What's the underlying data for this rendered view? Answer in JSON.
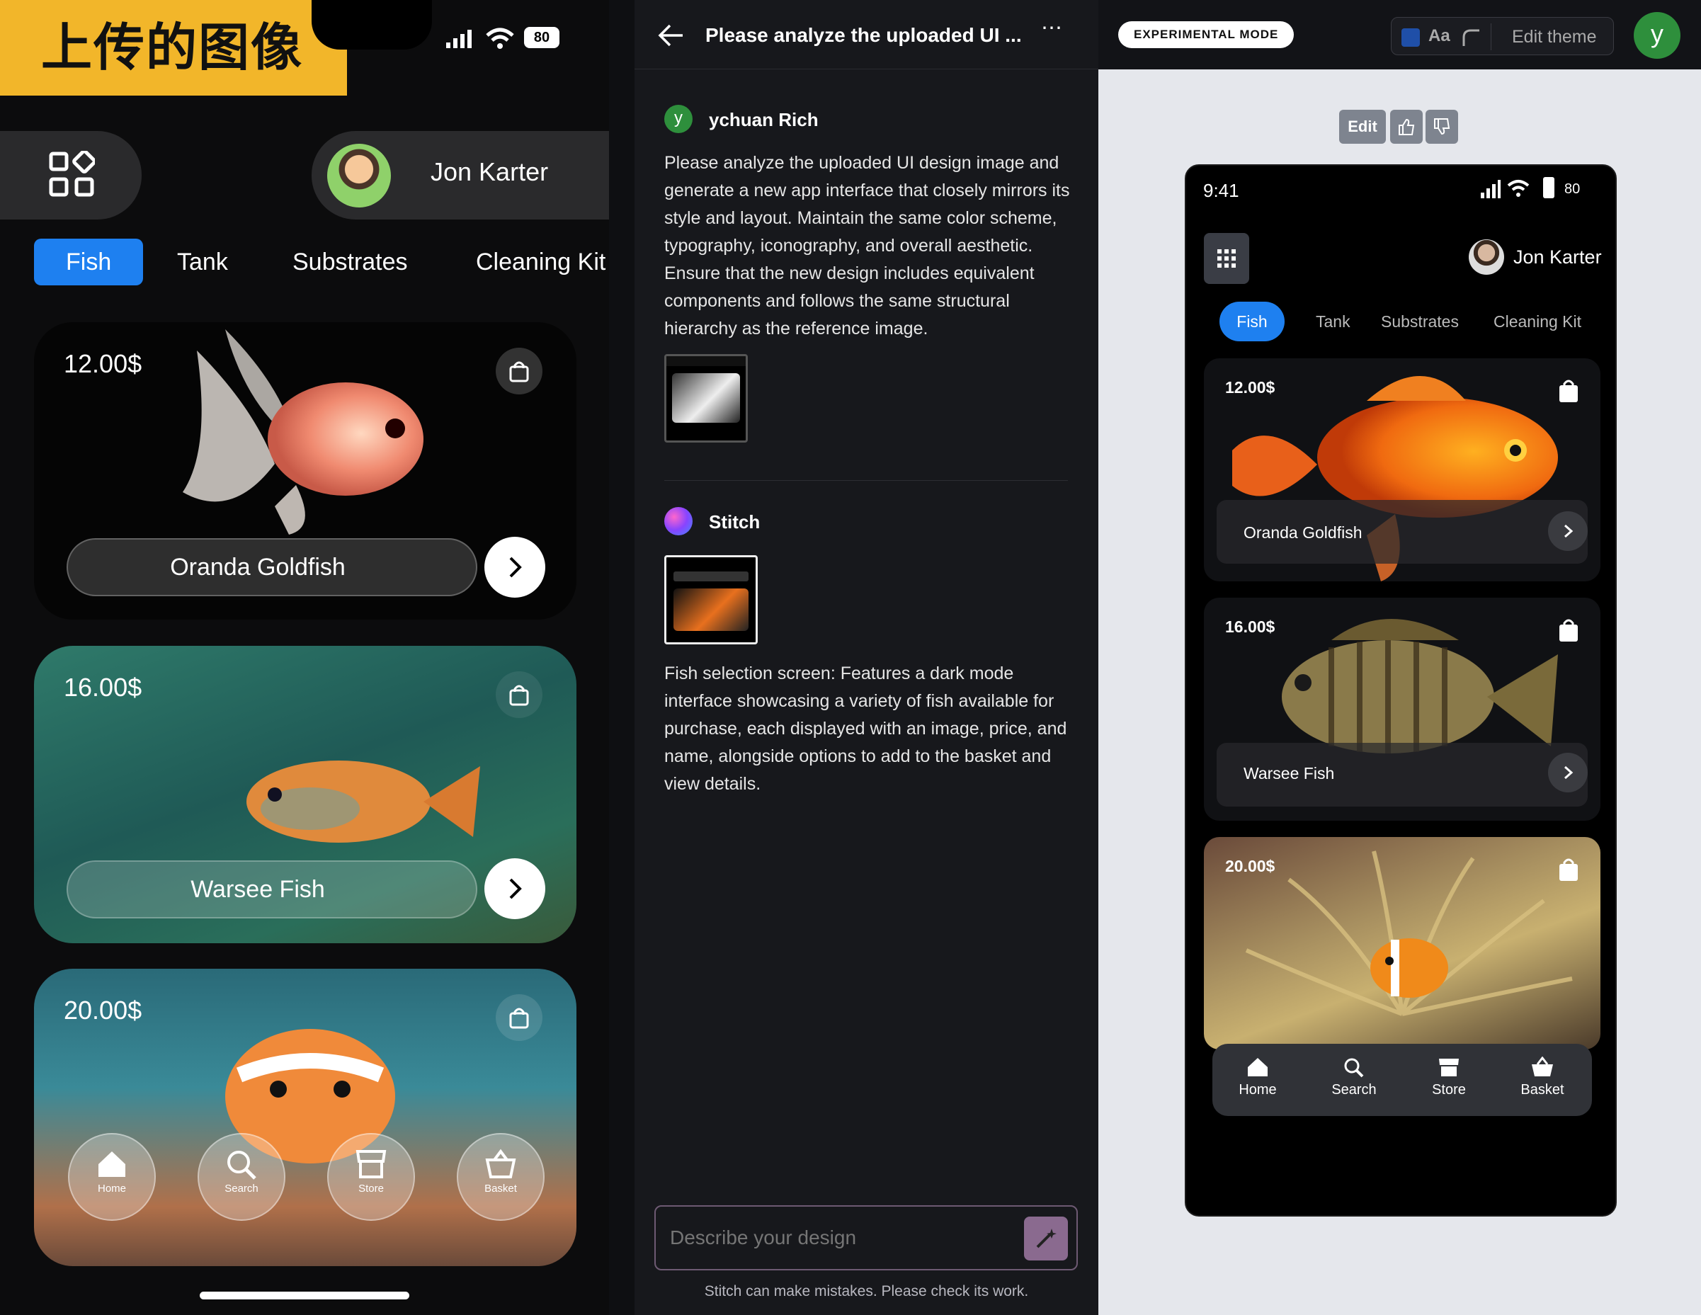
{
  "uploaded": {
    "banner": "上传的图像",
    "battery": "80",
    "user_name": "Jon Karter",
    "tabs": [
      "Fish",
      "Tank",
      "Substrates",
      "Cleaning Kit"
    ],
    "cards": [
      {
        "price": "12.00$",
        "name": "Oranda Goldfish"
      },
      {
        "price": "16.00$",
        "name": "Warsee Fish"
      },
      {
        "price": "20.00$"
      }
    ],
    "nav": [
      "Home",
      "Search",
      "Store",
      "Basket"
    ]
  },
  "chat": {
    "title": "Please analyze the uploaded UI ...",
    "user_initial": "y",
    "user_name": "ychuan Rich",
    "user_message": "Please analyze the uploaded UI design image and generate a new app interface that closely mirrors its style and layout. Maintain the same color scheme, typography, iconography, and overall aesthetic. Ensure that the new design includes equivalent components and follows the same structural hierarchy as the reference image.",
    "bot_name": "Stitch",
    "bot_message": "Fish selection screen: Features a dark mode interface showcasing a variety of fish available for purchase, each displayed with an image, price, and name, alongside options to add to the basket and view details.",
    "input_placeholder": "Describe your design",
    "footer": "Stitch can make mistakes. Please check its work."
  },
  "preview": {
    "mode_badge": "EXPERIMENTAL MODE",
    "font_label": "Aa",
    "edit_theme": "Edit theme",
    "avatar": "y",
    "edit_button": "Edit",
    "phone": {
      "time": "9:41",
      "battery": "80",
      "user_name": "Jon Karter",
      "tabs": [
        "Fish",
        "Tank",
        "Substrates",
        "Cleaning Kit"
      ],
      "cards": [
        {
          "price": "12.00$",
          "name": "Oranda Goldfish"
        },
        {
          "price": "16.00$",
          "name": "Warsee Fish"
        },
        {
          "price": "20.00$"
        }
      ],
      "nav": [
        "Home",
        "Search",
        "Store",
        "Basket"
      ]
    }
  },
  "colors": {
    "accent_blue": "#1e80f0",
    "banner_yellow": "#f2b62a",
    "avatar_green": "#2e8f3c"
  }
}
